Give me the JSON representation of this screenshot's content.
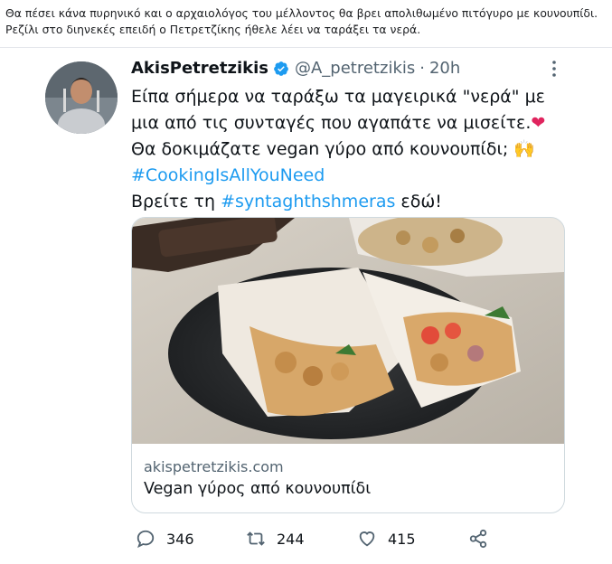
{
  "post": {
    "caption": "Θα πέσει κάνα πυρηνικό και ο αρχαιολόγος του μέλλοντος θα βρει απολιθωμένο πιτόγυρο με κουνουπίδι. Ρεζίλι στο διηνεκές επειδή ο Πετρετζίκης ήθελε λέει να ταράξει τα νερά."
  },
  "tweet": {
    "display_name": "AkisPetretzikis",
    "handle": "@A_petretzikis",
    "separator": "·",
    "time": "20h",
    "line1": "Είπα σήμερα να ταράξω τα μαγειρικά \"νερά\" με μια από τις συνταγές που αγαπάτε να μισείτε.",
    "emoji_heart": "❤",
    "line2": "Θα δοκιμάζατε vegan γύρο από κουνουπίδι;",
    "emoji_hands": "🙌",
    "hashtag1": "#CookingIsAllYouNeed",
    "line3_prefix": "Βρείτε τη",
    "hashtag2": "#syntaghthshmeras",
    "line3_suffix": "εδώ!",
    "card": {
      "domain": "akispetretzikis.com",
      "title": "Vegan γύρος από κουνουπίδι"
    },
    "stats": {
      "replies": "346",
      "retweets": "244",
      "likes": "415"
    }
  },
  "colors": {
    "accent": "#1d9bf0",
    "heart": "#e0245e",
    "muted": "#536471"
  }
}
